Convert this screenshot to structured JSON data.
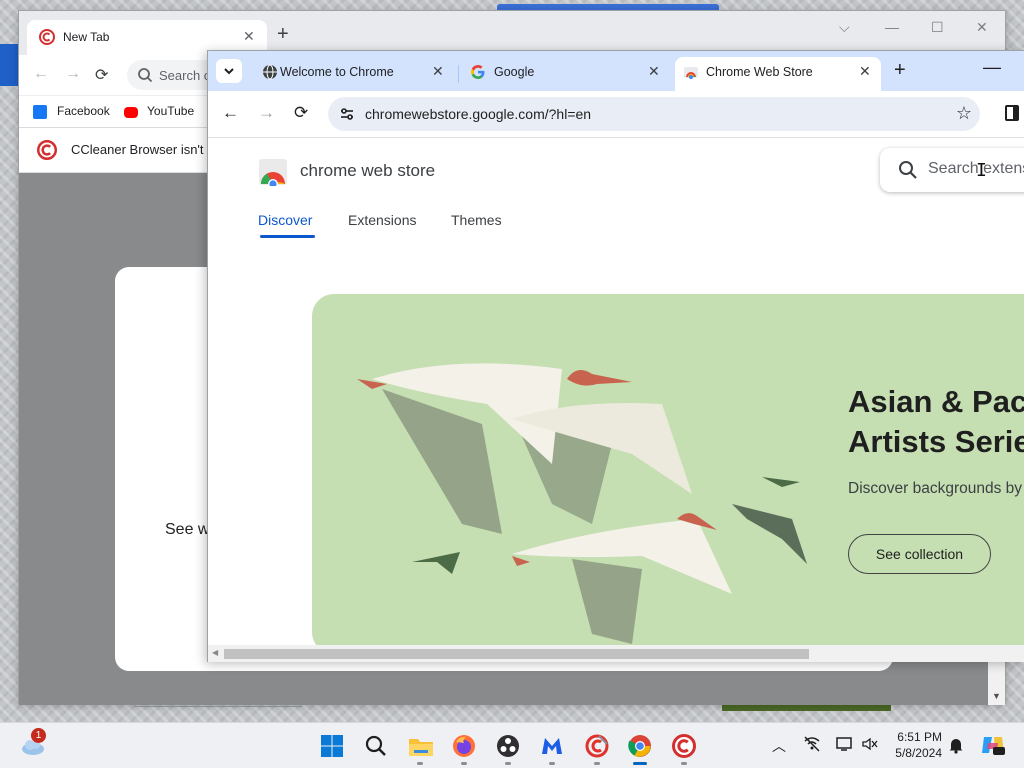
{
  "back_window": {
    "tab_title": "New Tab",
    "search_placeholder": "Search c",
    "bookmarks": [
      "Facebook",
      "YouTube"
    ],
    "infobar_text": "CCleaner Browser isn't y",
    "dialog_text": "See w"
  },
  "front_window": {
    "tabs": [
      {
        "title": "Welcome to Chrome",
        "icon": "globe-icon"
      },
      {
        "title": "Google",
        "icon": "google-g-icon"
      },
      {
        "title": "Chrome Web Store",
        "icon": "chrome-web-store-icon",
        "active": true
      }
    ],
    "url": "chromewebstore.google.com/?hl=en"
  },
  "store": {
    "brand": "chrome web store",
    "search_placeholder": "Search extensions and themes",
    "nav": [
      "Discover",
      "Extensions",
      "Themes"
    ],
    "nav_active": "Discover",
    "hero": {
      "title_line1": "Asian & Pacific Islander",
      "title_line2": "Artists Series",
      "description": "Discover backgrounds by Asian & Pacific Islander artists",
      "button": "See collection"
    }
  },
  "taskbar": {
    "weather_badge": "1",
    "time": "6:51 PM",
    "date": "5/8/2024",
    "apps": [
      "start-icon",
      "search-icon",
      "file-explorer-icon",
      "firefox-icon",
      "obs-icon",
      "malwarebytes-icon",
      "ccleaner-icon",
      "chrome-icon",
      "ccleaner-browser-icon"
    ]
  },
  "colors": {
    "accent": "#0b57d0",
    "tabstrip": "#d3e3fd",
    "hero_bg": "#c5dfb2"
  }
}
